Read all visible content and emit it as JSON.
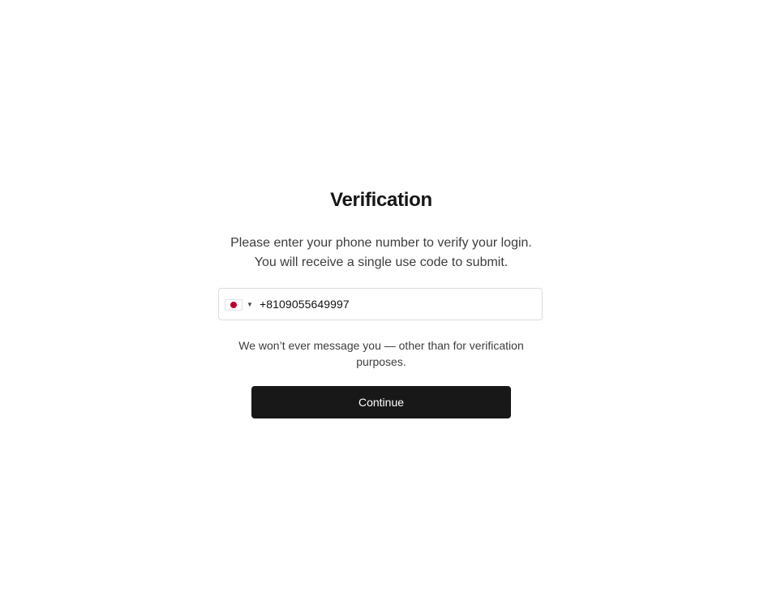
{
  "page": {
    "title": "Verification",
    "description_line1": "Please enter your phone number to verify your login.",
    "description_line2": "You will receive a single use code to submit."
  },
  "phone": {
    "country_flag": "japan-flag",
    "value": "+8109055649997"
  },
  "note": "We won’t ever message you — other than for verification purposes.",
  "continue_label": "Continue",
  "colors": {
    "background": "#ffffff",
    "button": "#181818",
    "button_text": "#ffffff",
    "flag_red": "#bc002d"
  }
}
